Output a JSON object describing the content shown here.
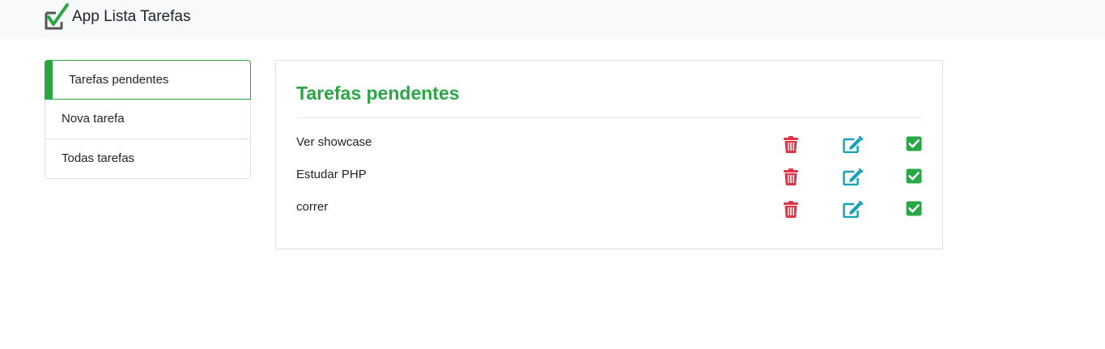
{
  "navbar": {
    "brand_text": "App Lista Tarefas",
    "logo_icon": "checkbox-check-icon"
  },
  "sidebar": {
    "items": [
      {
        "label": "Tarefas pendentes",
        "active": true
      },
      {
        "label": "Nova tarefa",
        "active": false
      },
      {
        "label": "Todas tarefas",
        "active": false
      }
    ]
  },
  "main": {
    "title": "Tarefas pendentes",
    "tasks": [
      {
        "text": "Ver showcase",
        "actions": [
          "trash-icon",
          "edit-icon",
          "check-square-icon"
        ]
      },
      {
        "text": "Estudar PHP",
        "actions": [
          "trash-icon",
          "edit-icon",
          "check-square-icon"
        ]
      },
      {
        "text": "correr",
        "actions": [
          "trash-icon",
          "edit-icon",
          "check-square-icon"
        ]
      }
    ]
  },
  "colors": {
    "accent_green": "#28a745",
    "danger_red": "#dc3545",
    "info_teal": "#17a2b8",
    "navbar_bg": "#f8f9fa"
  }
}
